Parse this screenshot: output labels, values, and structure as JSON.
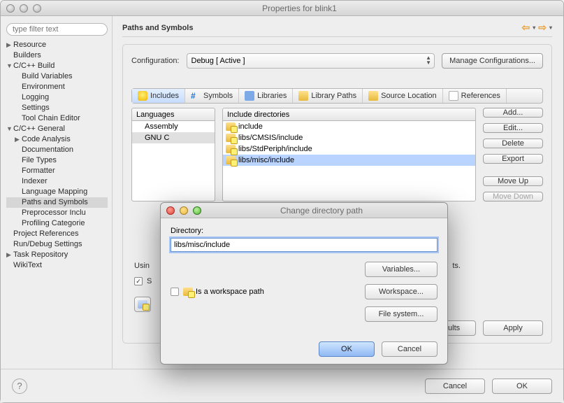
{
  "window": {
    "title": "Properties for blink1"
  },
  "sidebar": {
    "filter_placeholder": "type filter text",
    "items": [
      {
        "label": "Resource",
        "level": 0,
        "arrow": "▶"
      },
      {
        "label": "Builders",
        "level": 0,
        "arrow": ""
      },
      {
        "label": "C/C++ Build",
        "level": 0,
        "arrow": "▼"
      },
      {
        "label": "Build Variables",
        "level": 1,
        "arrow": ""
      },
      {
        "label": "Environment",
        "level": 1,
        "arrow": ""
      },
      {
        "label": "Logging",
        "level": 1,
        "arrow": ""
      },
      {
        "label": "Settings",
        "level": 1,
        "arrow": ""
      },
      {
        "label": "Tool Chain Editor",
        "level": 1,
        "arrow": ""
      },
      {
        "label": "C/C++ General",
        "level": 0,
        "arrow": "▼"
      },
      {
        "label": "Code Analysis",
        "level": 1,
        "arrow": "▶"
      },
      {
        "label": "Documentation",
        "level": 1,
        "arrow": ""
      },
      {
        "label": "File Types",
        "level": 1,
        "arrow": ""
      },
      {
        "label": "Formatter",
        "level": 1,
        "arrow": ""
      },
      {
        "label": "Indexer",
        "level": 1,
        "arrow": ""
      },
      {
        "label": "Language Mapping",
        "level": 1,
        "arrow": ""
      },
      {
        "label": "Paths and Symbols",
        "level": 1,
        "arrow": "",
        "selected": true
      },
      {
        "label": "Preprocessor Inclu",
        "level": 1,
        "arrow": ""
      },
      {
        "label": "Profiling Categorie",
        "level": 1,
        "arrow": ""
      },
      {
        "label": "Project References",
        "level": 0,
        "arrow": ""
      },
      {
        "label": "Run/Debug Settings",
        "level": 0,
        "arrow": ""
      },
      {
        "label": "Task Repository",
        "level": 0,
        "arrow": "▶"
      },
      {
        "label": "WikiText",
        "level": 0,
        "arrow": ""
      }
    ]
  },
  "heading": "Paths and Symbols",
  "config": {
    "label": "Configuration:",
    "value": "Debug  [ Active ]",
    "manage_label": "Manage Configurations..."
  },
  "tabs": [
    {
      "label": "Includes",
      "active": true
    },
    {
      "label": "Symbols"
    },
    {
      "label": "Libraries"
    },
    {
      "label": "Library Paths"
    },
    {
      "label": "Source Location"
    },
    {
      "label": "References"
    }
  ],
  "languages": {
    "header": "Languages",
    "items": [
      {
        "label": "Assembly"
      },
      {
        "label": "GNU C",
        "selected": true
      }
    ]
  },
  "includes": {
    "header": "Include directories",
    "items": [
      {
        "label": "include"
      },
      {
        "label": "libs/CMSIS/include"
      },
      {
        "label": "libs/StdPeriph/include"
      },
      {
        "label": "libs/misc/include",
        "highlight": true
      }
    ]
  },
  "side_buttons": {
    "add": "Add...",
    "edit": "Edit...",
    "delete": "Delete",
    "export": "Export",
    "move_up": "Move Up",
    "move_down": "Move Down"
  },
  "lower": {
    "usin": "Usin",
    "ts": "ts.",
    "show_checked": true,
    "show_prefix": "S"
  },
  "panel_bottom": {
    "defaults": "Defaults",
    "apply": "Apply"
  },
  "footer": {
    "cancel": "Cancel",
    "ok": "OK"
  },
  "dialog": {
    "title": "Change directory path",
    "label": "Directory:",
    "value": "libs/misc/include",
    "is_workspace_label": "Is a workspace path",
    "is_workspace_checked": false,
    "variables": "Variables...",
    "workspace": "Workspace...",
    "filesystem": "File system...",
    "ok": "OK",
    "cancel": "Cancel"
  }
}
